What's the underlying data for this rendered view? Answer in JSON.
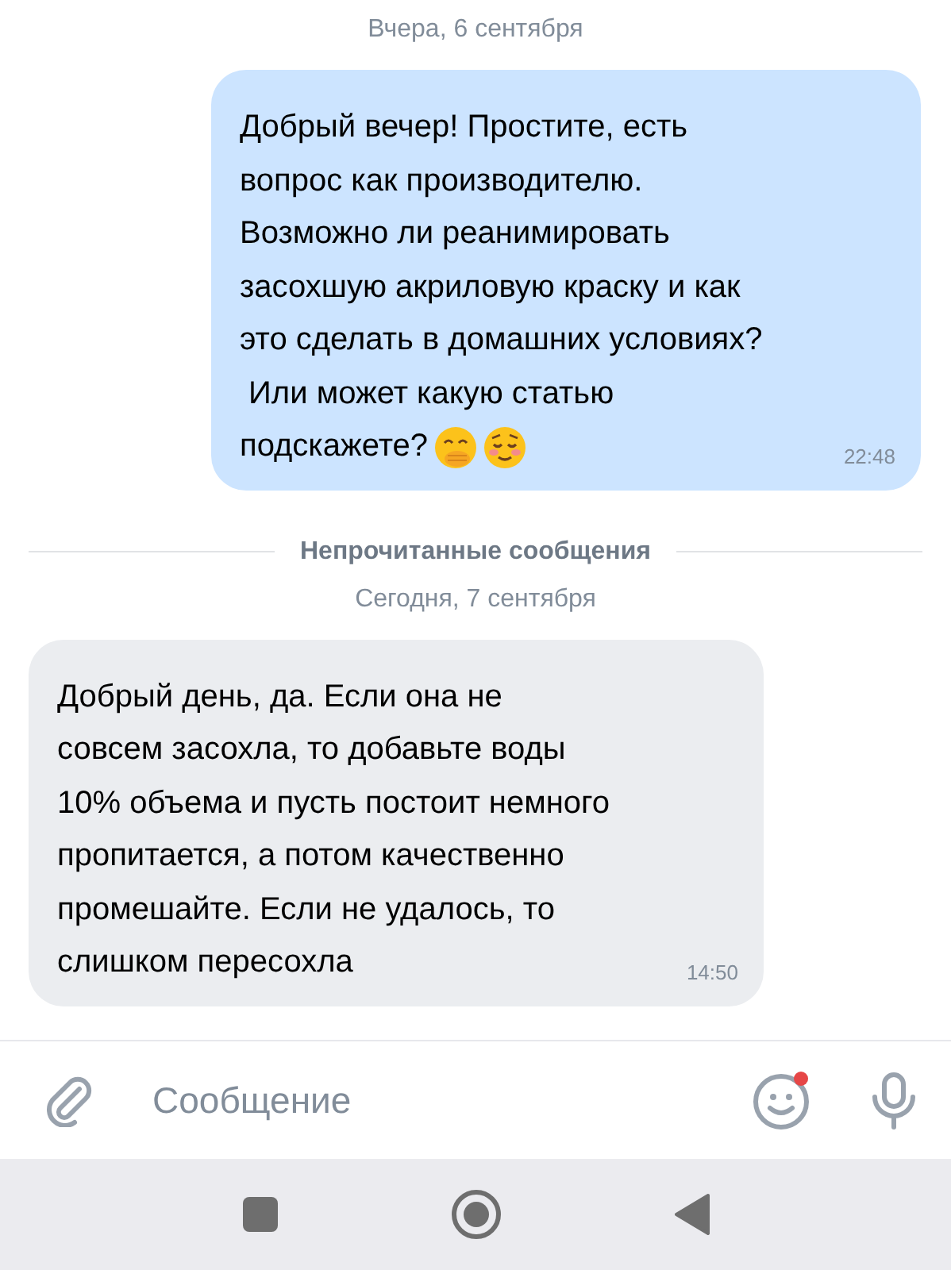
{
  "feed": [
    {
      "kind": "date",
      "text": "Вчера, 6 сентября"
    },
    {
      "kind": "outgoing",
      "lines": [
        "Добрый вечер! Простите, есть",
        "вопрос как производителю.",
        "Возможно ли реанимировать",
        "засохшую акриловую краску и как",
        "это сделать в домашних условиях?",
        " Или может какую статью",
        "подскажете?"
      ],
      "emoji": [
        {
          "kind": "hand-over-mouth"
        },
        {
          "kind": "blush"
        }
      ],
      "time": "22:48"
    },
    {
      "kind": "divider",
      "text": "Непрочитанные сообщения"
    },
    {
      "kind": "date",
      "text": "Сегодня, 7 сентября"
    },
    {
      "kind": "incoming",
      "lines": [
        "Добрый день, да. Если она не",
        "совсем засохла, то добавьте воды",
        "10% объема и пусть постоит немного",
        "пропитается, а потом качественно",
        "промешайте. Если не удалось, то",
        "слишком пересохла"
      ],
      "time": "14:50"
    }
  ],
  "composer": {
    "placeholder": "Сообщение",
    "emoji_badge": true
  }
}
